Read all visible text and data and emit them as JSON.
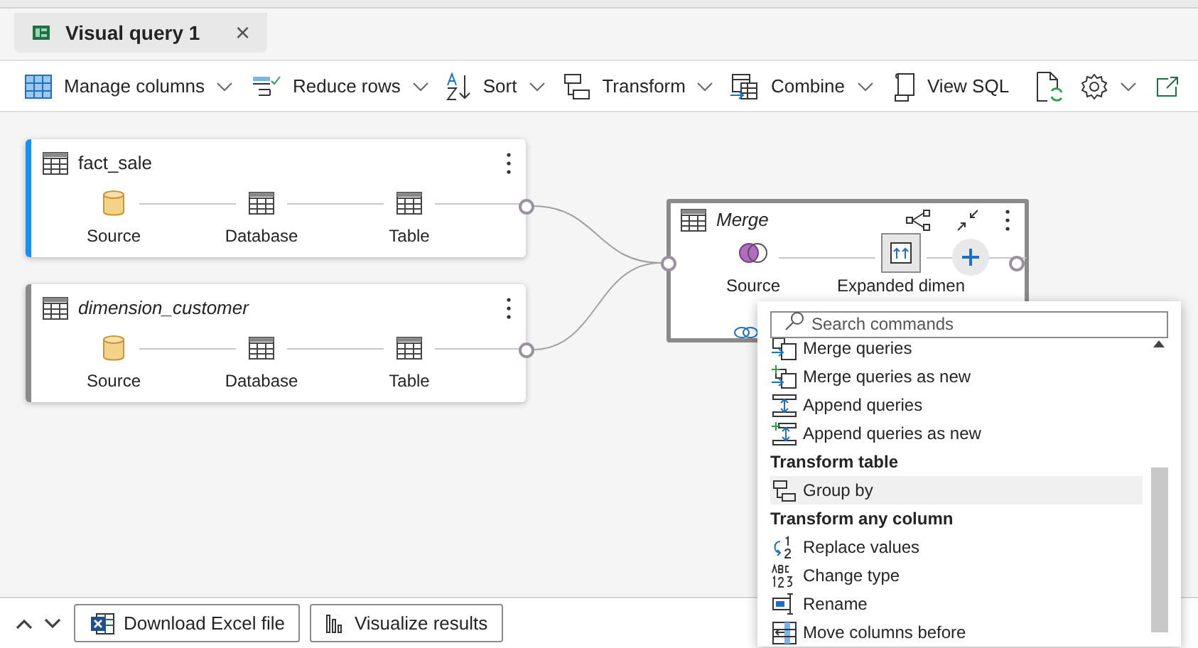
{
  "tab": {
    "title": "Visual query 1",
    "close": "×"
  },
  "toolbar": [
    {
      "label": "Manage columns",
      "dropdown": true
    },
    {
      "label": "Reduce rows",
      "dropdown": true
    },
    {
      "label": "Sort",
      "dropdown": true
    },
    {
      "label": "Transform",
      "dropdown": true
    },
    {
      "label": "Combine",
      "dropdown": true
    },
    {
      "label": "View SQL",
      "dropdown": false
    }
  ],
  "queries": [
    {
      "title": "fact_sale",
      "italic": false,
      "selected": true,
      "steps": [
        {
          "kind": "source",
          "label": "Source"
        },
        {
          "kind": "table",
          "label": "Database"
        },
        {
          "kind": "table",
          "label": "Table"
        }
      ]
    },
    {
      "title": "dimension_customer",
      "italic": true,
      "selected": false,
      "steps": [
        {
          "kind": "source",
          "label": "Source"
        },
        {
          "kind": "table",
          "label": "Database"
        },
        {
          "kind": "table",
          "label": "Table"
        }
      ]
    }
  ],
  "merge": {
    "title": "Merge",
    "italic": true,
    "steps": [
      {
        "kind": "merge",
        "label": "Source",
        "selected": false
      },
      {
        "kind": "expand",
        "label": "Expanded dimen",
        "selected": true
      }
    ]
  },
  "command_menu": {
    "search": {
      "placeholder": "Search commands"
    },
    "items": [
      {
        "kind": "item",
        "label": "Merge queries",
        "selected": false
      },
      {
        "kind": "item",
        "label": "Merge queries as new",
        "selected": false
      },
      {
        "kind": "item",
        "label": "Append queries",
        "selected": false
      },
      {
        "kind": "item",
        "label": "Append queries as new",
        "selected": false
      },
      {
        "kind": "header",
        "label": "Transform table"
      },
      {
        "kind": "item",
        "label": "Group by",
        "selected": true
      },
      {
        "kind": "header",
        "label": "Transform any column"
      },
      {
        "kind": "item",
        "label": "Replace values",
        "selected": false
      },
      {
        "kind": "item",
        "label": "Change type",
        "selected": false
      },
      {
        "kind": "item",
        "label": "Rename",
        "selected": false
      },
      {
        "kind": "item",
        "label": "Move columns before",
        "selected": false
      }
    ]
  },
  "bottom_bar": {
    "buttons": [
      "Download Excel file",
      "Visualize results"
    ]
  }
}
